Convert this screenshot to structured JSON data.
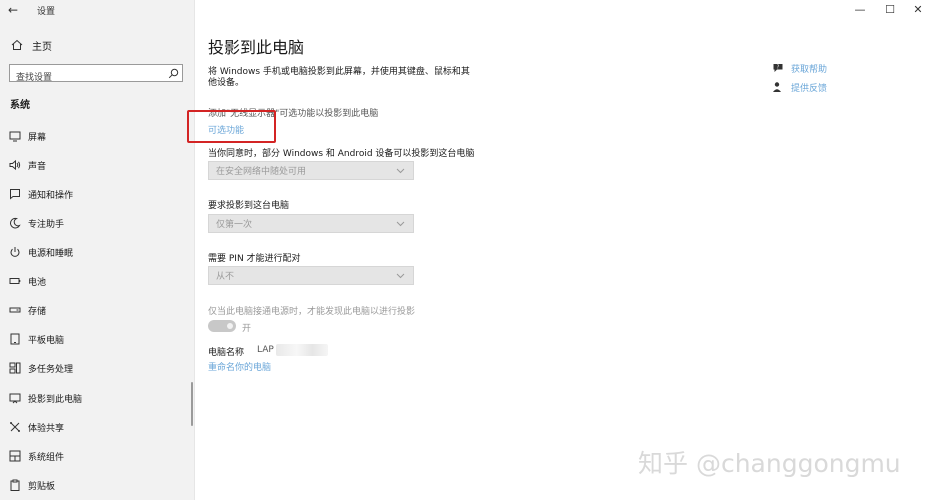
{
  "window": {
    "title": "设置",
    "back_glyph": "←",
    "minimize_glyph": "—",
    "maximize_glyph": "☐",
    "close_glyph": "✕"
  },
  "sidebar": {
    "home_label": "主页",
    "search_placeholder": "查找设置",
    "section": "系统",
    "items": [
      {
        "label": "屏幕",
        "icon": "monitor-icon"
      },
      {
        "label": "声音",
        "icon": "speaker-icon"
      },
      {
        "label": "通知和操作",
        "icon": "notification-icon"
      },
      {
        "label": "专注助手",
        "icon": "moon-icon"
      },
      {
        "label": "电源和睡眠",
        "icon": "power-icon"
      },
      {
        "label": "电池",
        "icon": "battery-icon"
      },
      {
        "label": "存储",
        "icon": "storage-icon"
      },
      {
        "label": "平板电脑",
        "icon": "tablet-icon"
      },
      {
        "label": "多任务处理",
        "icon": "multitask-icon"
      },
      {
        "label": "投影到此电脑",
        "icon": "project-icon",
        "active": true
      },
      {
        "label": "体验共享",
        "icon": "share-icon"
      },
      {
        "label": "系统组件",
        "icon": "components-icon"
      },
      {
        "label": "剪贴板",
        "icon": "clipboard-icon"
      }
    ]
  },
  "main": {
    "title": "投影到此电脑",
    "description": "将 Windows 手机或电脑投影到此屏幕，并使用其键盘、鼠标和其他设备。",
    "add_text": "添加\"无线显示器\"可选功能以投影到此电脑",
    "optional_features_link": "可选功能",
    "availability_label": "当你同意时，部分 Windows 和 Android 设备可以投影到这台电脑",
    "availability_value": "在安全网络中随处可用",
    "ask_label": "要求投影到这台电脑",
    "ask_value": "仅第一次",
    "pin_label": "需要 PIN 才能进行配对",
    "pin_value": "从不",
    "power_label": "仅当此电脑接通电源时，才能发现此电脑以进行投影",
    "toggle_label": "开",
    "pc_name_label": "电脑名称",
    "pc_name_value": "LAP",
    "rename_link": "重命名你的电脑"
  },
  "help": {
    "get_help": "获取帮助",
    "feedback": "提供反馈"
  },
  "watermark": "知乎 @changgongmu",
  "colors": {
    "accent_link": "#6aa6d8",
    "highlight_box": "#d32424"
  }
}
